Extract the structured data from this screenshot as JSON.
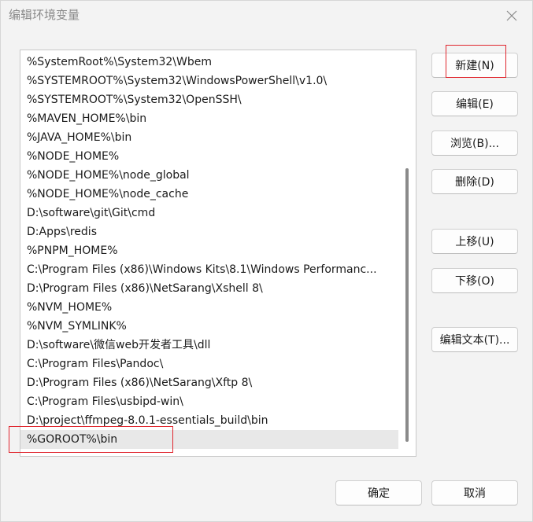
{
  "window": {
    "title": "编辑环境变量",
    "close_icon": "close-icon"
  },
  "path_list": {
    "items": [
      "%SystemRoot%\\System32\\Wbem",
      "%SYSTEMROOT%\\System32\\WindowsPowerShell\\v1.0\\",
      "%SYSTEMROOT%\\System32\\OpenSSH\\",
      "%MAVEN_HOME%\\bin",
      "%JAVA_HOME%\\bin",
      "%NODE_HOME%",
      "%NODE_HOME%\\node_global",
      "%NODE_HOME%\\node_cache",
      "D:\\software\\git\\Git\\cmd",
      "D:Apps\\redis",
      "%PNPM_HOME%",
      "C:\\Program Files (x86)\\Windows Kits\\8.1\\Windows Performanc...",
      "D:\\Program Files (x86)\\NetSarang\\Xshell 8\\",
      "%NVM_HOME%",
      "%NVM_SYMLINK%",
      "D:\\software\\微信web开发者工具\\dll",
      "C:\\Program Files\\Pandoc\\",
      "D:\\Program Files (x86)\\NetSarang\\Xftp 8\\",
      "C:\\Program Files\\usbipd-win\\",
      "D:\\project\\ffmpeg-8.0.1-essentials_build\\bin",
      "%GOROOT%\\bin"
    ],
    "selected_index": 20
  },
  "buttons": {
    "new": "新建(N)",
    "edit": "编辑(E)",
    "browse": "浏览(B)...",
    "delete": "删除(D)",
    "move_up": "上移(U)",
    "move_down": "下移(O)",
    "edit_text": "编辑文本(T)...",
    "ok": "确定",
    "cancel": "取消"
  },
  "colors": {
    "highlight_annotation": "#e0262e",
    "selected_row": "#e8e8e8"
  }
}
